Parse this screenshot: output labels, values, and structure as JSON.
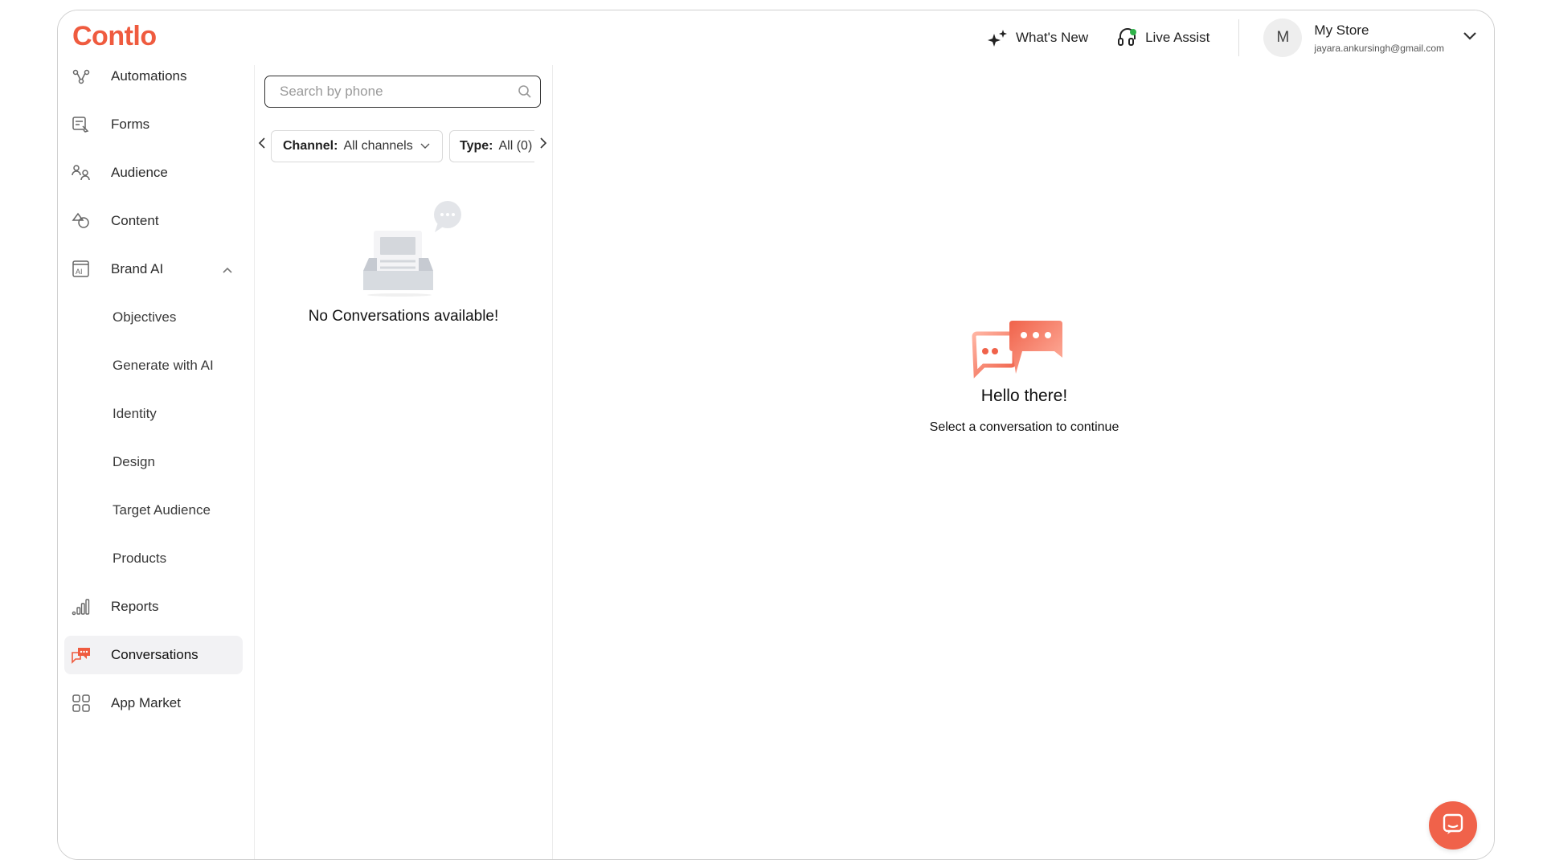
{
  "brand": {
    "logo_text": "Contlo",
    "accent": "#ef5b3f"
  },
  "header": {
    "whats_new_label": "What's New",
    "live_assist_label": "Live Assist",
    "avatar_initial": "M",
    "store_name": "My Store",
    "store_email": "jayara.ankursingh@gmail.com"
  },
  "sidebar": {
    "items": [
      {
        "label": "Automations",
        "icon": "automations-icon"
      },
      {
        "label": "Forms",
        "icon": "forms-icon"
      },
      {
        "label": "Audience",
        "icon": "audience-icon"
      },
      {
        "label": "Content",
        "icon": "content-icon"
      },
      {
        "label": "Brand AI",
        "icon": "brand-ai-icon",
        "expanded": true
      },
      {
        "label": "Objectives"
      },
      {
        "label": "Generate with AI"
      },
      {
        "label": "Identity"
      },
      {
        "label": "Design"
      },
      {
        "label": "Target Audience"
      },
      {
        "label": "Products"
      },
      {
        "label": "Reports",
        "icon": "reports-icon"
      },
      {
        "label": "Conversations",
        "icon": "conversations-icon",
        "active": true
      },
      {
        "label": "App Market",
        "icon": "app-market-icon"
      }
    ]
  },
  "conversations": {
    "search_placeholder": "Search by phone",
    "channel_filter": {
      "label": "Channel:",
      "value": "All channels"
    },
    "type_filter": {
      "label": "Type:",
      "value": "All (0)"
    },
    "empty_text": "No Conversations available!"
  },
  "main": {
    "greeting": "Hello there!",
    "subtext": "Select a conversation to continue"
  }
}
